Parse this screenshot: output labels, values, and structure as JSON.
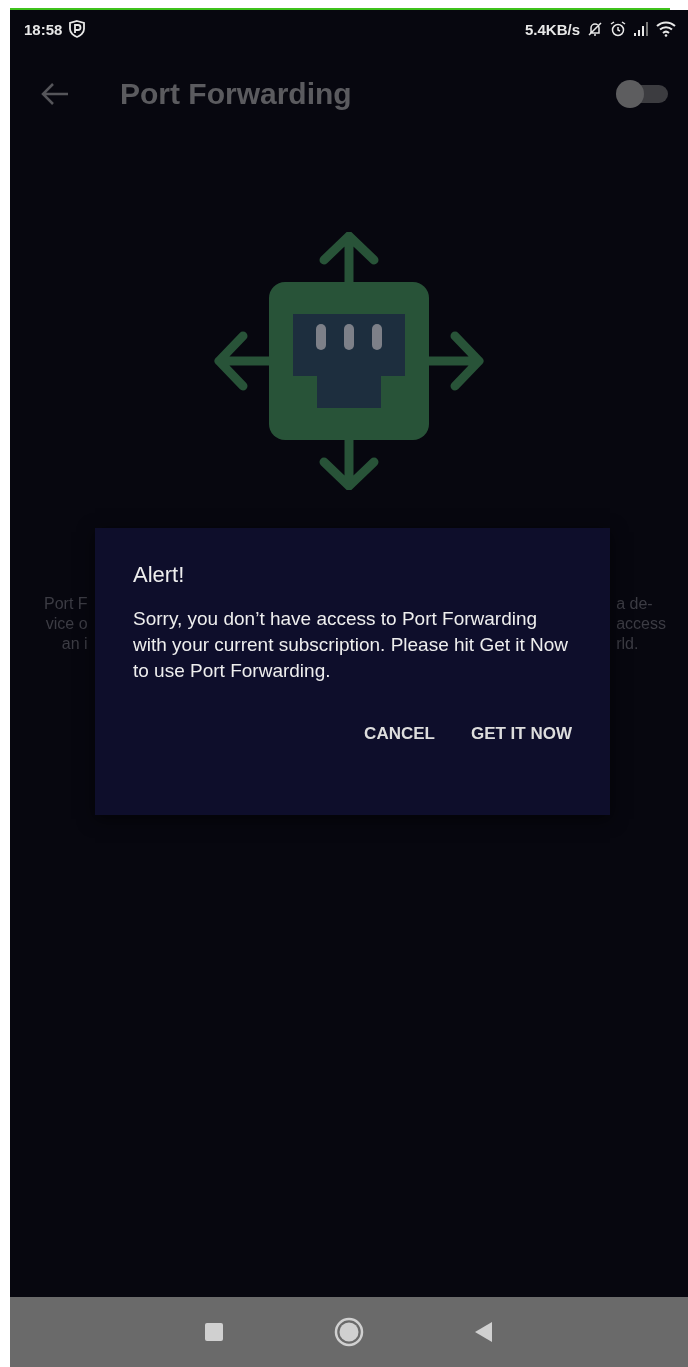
{
  "status_bar": {
    "time": "18:58",
    "speed": "5.4KB/s"
  },
  "app_bar": {
    "title": "Port Forwarding",
    "toggle": {
      "on": false
    }
  },
  "background_text": {
    "left_lines": [
      "Port F",
      "vice o",
      "an i"
    ],
    "right_lines": [
      "a de-",
      "access",
      "rld."
    ]
  },
  "dialog": {
    "title": "Alert!",
    "message": "Sorry, you don’t have access to Port Forwarding with your current subscription. Please hit Get it Now to use Port Forwarding.",
    "buttons": [
      "CANCEL",
      "GET IT NOW"
    ]
  }
}
